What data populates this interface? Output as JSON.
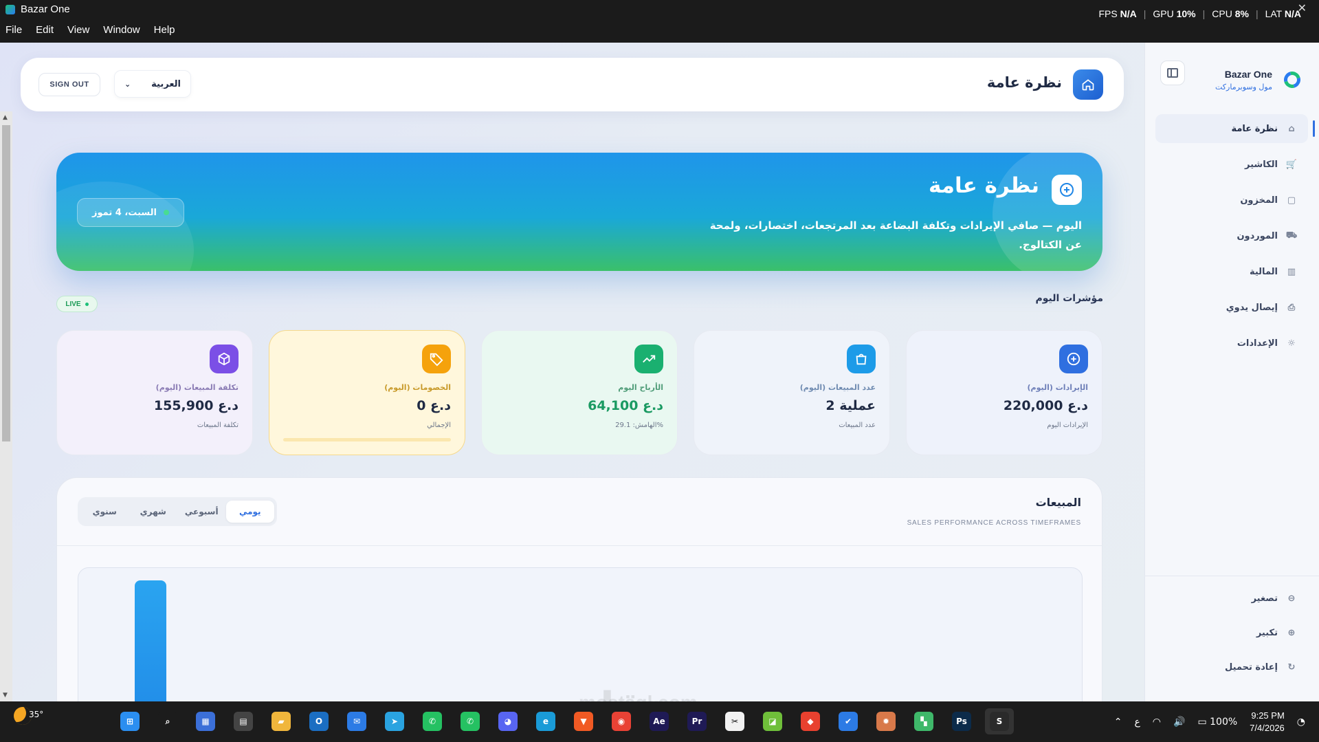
{
  "window": {
    "title": "Bazar One",
    "menu": [
      "File",
      "Edit",
      "View",
      "Window",
      "Help"
    ],
    "perf": {
      "fps_label": "FPS",
      "fps_value": "N/A",
      "gpu_label": "GPU",
      "gpu_value": "10%",
      "cpu_label": "CPU",
      "cpu_value": "8%",
      "lat_label": "LAT",
      "lat_value": "N/A",
      "sep": "|"
    },
    "close_glyph": "✕"
  },
  "sidebar": {
    "brand_name": "Bazar One",
    "brand_sub": "مول وسوبرماركت",
    "items": [
      {
        "label": "نظرة عامة",
        "icon": "home-icon",
        "glyph": "⌂"
      },
      {
        "label": "الكاشير",
        "icon": "cart-icon",
        "glyph": "🛒"
      },
      {
        "label": "المخزون",
        "icon": "bag-icon",
        "glyph": "▢"
      },
      {
        "label": "الموردون",
        "icon": "truck-icon",
        "glyph": "⛟"
      },
      {
        "label": "المالية",
        "icon": "bar-chart-icon",
        "glyph": "▥"
      },
      {
        "label": "إيصال يدوي",
        "icon": "printer-icon",
        "glyph": "⎙"
      },
      {
        "label": "الإعدادات",
        "icon": "gear-icon",
        "glyph": "☼"
      }
    ],
    "bottom": [
      {
        "label": "تصغير",
        "icon": "zoom-out-icon",
        "glyph": "⊖"
      },
      {
        "label": "تكبير",
        "icon": "zoom-in-icon",
        "glyph": "⊕"
      },
      {
        "label": "إعادة تحميل",
        "icon": "reload-icon",
        "glyph": "↻"
      }
    ]
  },
  "header": {
    "title": "نظرة عامة",
    "signout": "SIGN OUT",
    "language": "العربية",
    "lang_chevron": "⌄"
  },
  "hero": {
    "title": "نظرة عامة",
    "description": "اليوم — صافي الإيرادات وتكلفة البضاعة بعد المرتجعات، اختصارات، ولمحة عن الكتالوج.",
    "date": "السبت، 4 تموز",
    "plus_glyph": "+"
  },
  "kpis": {
    "heading": "مؤشرات اليوم",
    "live": "LIVE",
    "cards": [
      {
        "label": "الإيرادات (اليوم)",
        "value": "220,000 د.ع",
        "sub": "الإيرادات اليوم",
        "color": "#2f6fe0",
        "bg": "#eef2fb",
        "label_color": "#6e7fb8",
        "glyph": "+"
      },
      {
        "label": "عدد المبيعات (اليوم)",
        "value": "2 عملية",
        "sub": "عدد المبيعات",
        "color": "#1d9be8",
        "bg": "#eff3fa",
        "label_color": "#6e8ab0",
        "glyph": "⎘"
      },
      {
        "label": "الأرباح اليوم",
        "value": "64,100 د.ع",
        "sub": "الهامش: 29.1%",
        "color": "#1ab070",
        "bg": "#e9f8f1",
        "label_color": "#4f9c78",
        "glyph": "↗"
      },
      {
        "label": "الخصومات (اليوم)",
        "value": "0 د.ع",
        "sub": "الإجمالي",
        "color": "#f5a20c",
        "bg": "#fff7dc",
        "label_color": "#c89a2a",
        "glyph": "◈",
        "progress": 0
      },
      {
        "label": "تكلفة المبيعات (اليوم)",
        "value": "155,900 د.ع",
        "sub": "تكلفة المبيعات",
        "color": "#7b4fe6",
        "bg": "#f3f0fb",
        "label_color": "#8a7bb4",
        "glyph": "⬡"
      }
    ]
  },
  "sales": {
    "title": "المبيعات",
    "subtitle": "SALES PERFORMANCE ACROSS TIMEFRAMES",
    "tabs": [
      "يومي",
      "أسبوعي",
      "شهري",
      "سنوي"
    ],
    "active_tab": 0
  },
  "chart_data": {
    "type": "bar",
    "series": [
      {
        "values": [
          220000
        ]
      }
    ],
    "colors": [
      "#2aa4f0",
      "#1f86e6"
    ]
  },
  "watermark": {
    "ar": "مستقل",
    "en": "mostaql.com"
  },
  "taskbar": {
    "temperature": "35°",
    "apps": [
      {
        "icon": "windows-start-icon",
        "color": "#2b8ef0",
        "glyph": "⊞"
      },
      {
        "icon": "search-icon",
        "color": "#1c1c1c",
        "glyph": "⌕"
      },
      {
        "icon": "store-icon",
        "color": "#3b6fd8",
        "glyph": "▦"
      },
      {
        "icon": "calculator-icon",
        "color": "#444",
        "glyph": "▤"
      },
      {
        "icon": "folder-icon",
        "color": "#f0b63c",
        "glyph": "▰"
      },
      {
        "icon": "outlook-icon",
        "color": "#1b6ec2",
        "glyph": "O"
      },
      {
        "icon": "mail-icon",
        "color": "#2c7be5",
        "glyph": "✉"
      },
      {
        "icon": "telegram-icon",
        "color": "#2aa3e0",
        "glyph": "➤"
      },
      {
        "icon": "whatsapp-icon",
        "color": "#25c162",
        "glyph": "✆"
      },
      {
        "icon": "whatsapp-business-icon",
        "color": "#25c162",
        "glyph": "✆"
      },
      {
        "icon": "discord-icon",
        "color": "#5865f2",
        "glyph": "◕"
      },
      {
        "icon": "edge-icon",
        "color": "#1a9bd7",
        "glyph": "e"
      },
      {
        "icon": "brave-icon",
        "color": "#f15a24",
        "glyph": "▼"
      },
      {
        "icon": "chrome-icon",
        "color": "#e94235",
        "glyph": "◉"
      },
      {
        "icon": "after-effects-icon",
        "color": "#1f1a55",
        "glyph": "Ae"
      },
      {
        "icon": "premiere-icon",
        "color": "#1f1a55",
        "glyph": "Pr"
      },
      {
        "icon": "capcut-icon",
        "color": "#f2f2f2",
        "glyph": "✂"
      },
      {
        "icon": "app-green-icon",
        "color": "#6fbf3a",
        "glyph": "◪"
      },
      {
        "icon": "diamond-app-icon",
        "color": "#e8412f",
        "glyph": "◆"
      },
      {
        "icon": "check-app-icon",
        "color": "#2c7be5",
        "glyph": "✔"
      },
      {
        "icon": "claude-icon",
        "color": "#d8794a",
        "glyph": "✹"
      },
      {
        "icon": "blocks-app-icon",
        "color": "#3fb86a",
        "glyph": "▚"
      },
      {
        "icon": "photoshop-icon",
        "color": "#0c2b4a",
        "glyph": "Ps"
      },
      {
        "icon": "bazar-one-icon",
        "color": "#2a2a2a",
        "glyph": "S"
      }
    ],
    "tray": {
      "chevron": "⌃",
      "lang": "ع",
      "wifi_glyph": "◠",
      "volume_glyph": "🔊",
      "battery": "100%",
      "time": "9:25 PM",
      "date": "7/4/2026"
    }
  }
}
